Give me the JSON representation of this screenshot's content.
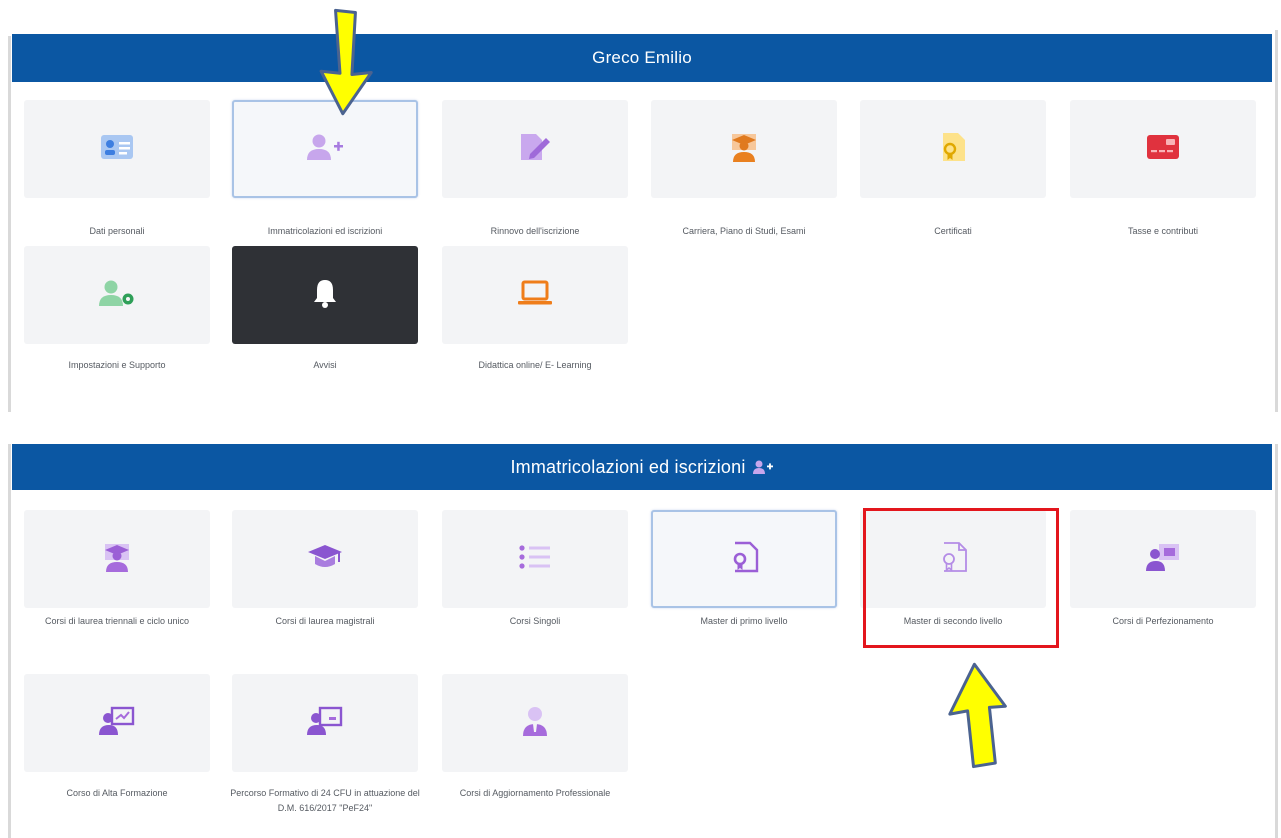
{
  "top_panel": {
    "title": "Greco Emilio",
    "cards": [
      {
        "label": "Dati personali",
        "icon": "id-card-icon"
      },
      {
        "label": "Immatricolazioni ed iscrizioni",
        "icon": "user-plus-icon"
      },
      {
        "label": "Rinnovo dell'iscrizione",
        "icon": "document-edit-icon"
      },
      {
        "label": "Carriera, Piano di Studi, Esami",
        "icon": "graduate-icon"
      },
      {
        "label": "Certificati",
        "icon": "certificate-icon"
      },
      {
        "label": "Tasse e contributi",
        "icon": "credit-card-icon"
      },
      {
        "label": "Impostazioni e Supporto",
        "icon": "user-settings-icon"
      },
      {
        "label": "Avvisi",
        "icon": "bell-icon"
      },
      {
        "label": "Didattica online/ E- Learning",
        "icon": "laptop-icon"
      }
    ]
  },
  "bottom_panel": {
    "title": "Immatricolazioni ed iscrizioni",
    "cards": [
      {
        "label": "Corsi di laurea triennali e ciclo unico",
        "icon": "graduate-student-icon"
      },
      {
        "label": "Corsi di laurea magistrali",
        "icon": "graduation-cap-icon"
      },
      {
        "label": "Corsi Singoli",
        "icon": "list-icon"
      },
      {
        "label": "Master di primo livello",
        "icon": "certificate-icon"
      },
      {
        "label": "Master di secondo livello",
        "icon": "certificate-outline-icon"
      },
      {
        "label": "Corsi di Perfezionamento",
        "icon": "presentation-icon"
      },
      {
        "label": "Corso di Alta Formazione",
        "icon": "chart-teacher-icon"
      },
      {
        "label": "Percorso Formativo di 24 CFU in attuazione del D.M. 616/2017 \"PeF24\"",
        "icon": "teacher-board-icon"
      },
      {
        "label": "Corsi di Aggiornamento Professionale",
        "icon": "professional-user-icon"
      }
    ]
  },
  "colors": {
    "header": "#0b57a3",
    "purple_icon": "#b48ce6",
    "highlight_red": "#e3161d",
    "arrow_yellow": "#ffff00"
  }
}
